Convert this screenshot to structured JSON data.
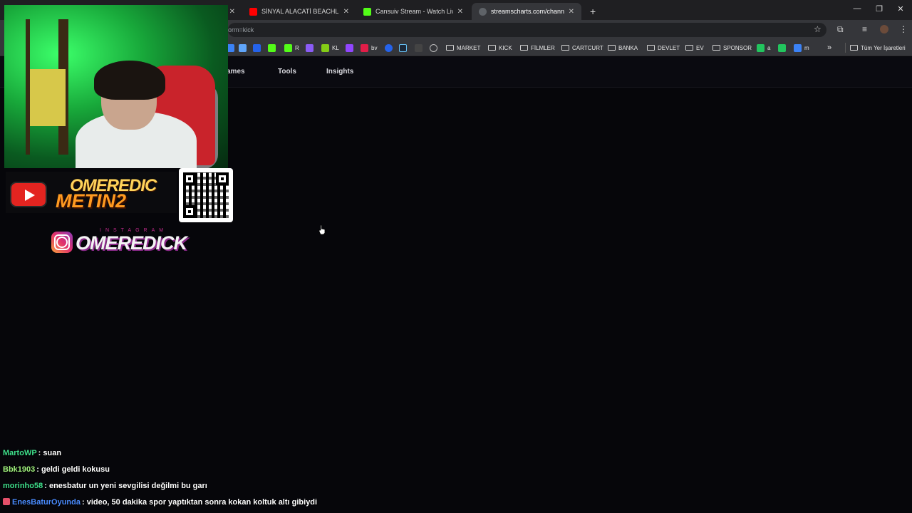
{
  "browser": {
    "tabs": [
      {
        "title": "",
        "color": "#888888"
      },
      {
        "title": "SİNYAL ALACATİ BEACHLERİNDE",
        "color": "#ff0000"
      },
      {
        "title": "Cansuiv Stream - Watch Live on",
        "color": "#53fc18"
      },
      {
        "title": "streamscharts.com/channels/o",
        "color": "#9aa0a6",
        "active": true
      }
    ],
    "new_tab": "+",
    "url_suffix": "orm=kick",
    "bookmarks": [
      {
        "label": "",
        "icon_color": "#3b82f6"
      },
      {
        "label": "",
        "icon_color": "#3b82f6"
      },
      {
        "label": "",
        "icon_color": "#3b82f6",
        "glyph": "m"
      },
      {
        "label": "",
        "icon_color": "#53fc18",
        "glyph": "K"
      },
      {
        "label": "R",
        "icon_color": "#53fc18",
        "glyph": "K"
      },
      {
        "label": "",
        "icon_color": "#8b5cf6"
      },
      {
        "label": "KL",
        "icon_color": "#84cc16",
        "glyph": "✖"
      },
      {
        "label": "",
        "icon_color": "#9146ff"
      },
      {
        "label": "bv",
        "icon_color": "#e11d48"
      },
      {
        "label": "",
        "icon_color": "#2563eb",
        "glyph": "R"
      },
      {
        "label": "",
        "icon_color": "#1b2838"
      },
      {
        "label": "",
        "icon_color": "#444444"
      },
      {
        "label": "",
        "icon_color": "#777777",
        "glyph": "⊕"
      }
    ],
    "bookmark_folders": [
      "MARKET",
      "KICK",
      "FİLMLER",
      "CARTCURT",
      "BANKA",
      "DEVLET",
      "EV",
      "SPONSOR"
    ],
    "bookmark_tail": [
      {
        "label": "a",
        "icon_color": "#22c55e"
      },
      {
        "label": "",
        "icon_color": "#22c55e"
      },
      {
        "label": "m",
        "icon_color": "#3b82f6"
      }
    ],
    "overflow": "»",
    "all_bookmarks": "Tüm Yer İşaretleri"
  },
  "site_nav": {
    "items": [
      "ames",
      "Tools",
      "Insights"
    ]
  },
  "overlay": {
    "banner_top": "OMEREDIC",
    "banner_bottom": "METIN2",
    "insta_sub": "INSTAGRAM",
    "insta_name": "OMEREDICK"
  },
  "chat": [
    {
      "user": "MartoWP",
      "color": "#3fe08c",
      "message": "suan"
    },
    {
      "user": "Bbk1903",
      "color": "#9ff07c",
      "message": "geldi geldi kokusu"
    },
    {
      "user": "morinho58",
      "color": "#3fe08c",
      "message": "enesbatur un yeni sevgilisi değilmi bu garı"
    },
    {
      "user": "EnesBaturOyunda",
      "color": "#4a8cff",
      "message": "video, 50 dakika spor yaptıktan sonra kokan koltuk altı gibiydi",
      "badge": true
    }
  ]
}
